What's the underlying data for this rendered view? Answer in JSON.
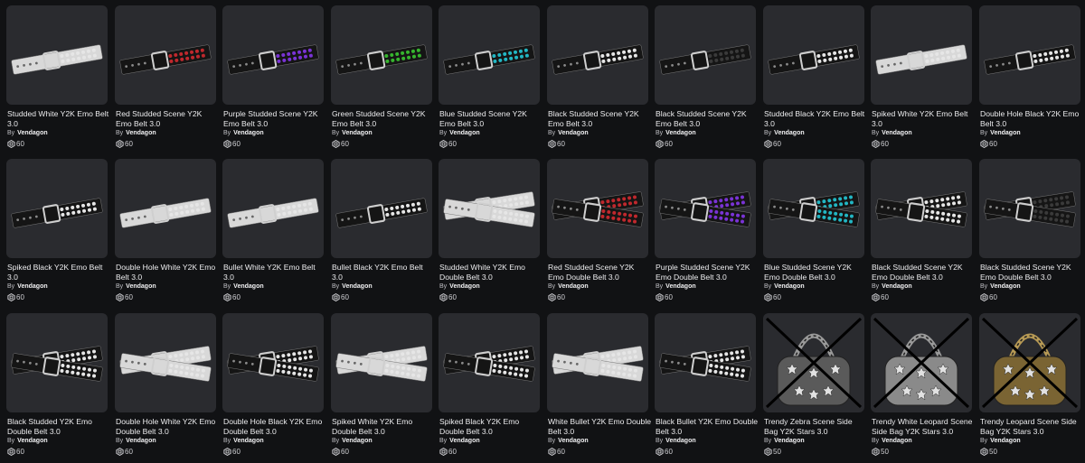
{
  "creator_prefix": "By",
  "colors": {
    "background": "#111214",
    "card_background": "#2a2b2f",
    "red": "#c0282d",
    "purple": "#7a33d6",
    "green": "#36b52e",
    "blue": "#22b6c3",
    "black": "#1a1a1a",
    "white": "#dcdcdc"
  },
  "items": [
    {
      "title": "Studded White Y2K Emo Belt 3.0",
      "creator": "Vendagon",
      "price": "60",
      "art": "belt",
      "strap": "white",
      "studs": "white",
      "crossed": false
    },
    {
      "title": "Red Studded Scene Y2K Emo Belt 3.0",
      "creator": "Vendagon",
      "price": "60",
      "art": "belt",
      "strap": "black",
      "studs": "red",
      "crossed": false
    },
    {
      "title": "Purple Studded Scene Y2K Emo Belt 3.0",
      "creator": "Vendagon",
      "price": "60",
      "art": "belt",
      "strap": "black",
      "studs": "purple",
      "crossed": false
    },
    {
      "title": "Green Studded Scene Y2K Emo Belt 3.0",
      "creator": "Vendagon",
      "price": "60",
      "art": "belt",
      "strap": "black",
      "studs": "green",
      "crossed": false
    },
    {
      "title": "Blue Studded Scene Y2K Emo Belt 3.0",
      "creator": "Vendagon",
      "price": "60",
      "art": "belt",
      "strap": "black",
      "studs": "blue",
      "crossed": false
    },
    {
      "title": "Black Studded Scene Y2K Emo Belt 3.0",
      "creator": "Vendagon",
      "price": "60",
      "art": "belt",
      "strap": "black",
      "studs": "white",
      "crossed": false
    },
    {
      "title": "Black Studded Scene Y2K Emo Belt 3.0",
      "creator": "Vendagon",
      "price": "60",
      "art": "belt",
      "strap": "black",
      "studs": "black",
      "crossed": false
    },
    {
      "title": "Studded Black Y2K Emo Belt 3.0",
      "creator": "Vendagon",
      "price": "60",
      "art": "belt",
      "strap": "black",
      "studs": "white",
      "crossed": false
    },
    {
      "title": "Spiked White Y2K Emo Belt 3.0",
      "creator": "Vendagon",
      "price": "60",
      "art": "belt",
      "strap": "white",
      "studs": "white",
      "crossed": false
    },
    {
      "title": "Double Hole Black Y2K Emo Belt 3.0",
      "creator": "Vendagon",
      "price": "60",
      "art": "belt",
      "strap": "black",
      "studs": "white",
      "crossed": false
    },
    {
      "title": "Spiked Black Y2K Emo Belt 3.0",
      "creator": "Vendagon",
      "price": "60",
      "art": "belt",
      "strap": "black",
      "studs": "white",
      "crossed": false
    },
    {
      "title": "Double Hole White Y2K Emo Belt 3.0",
      "creator": "Vendagon",
      "price": "60",
      "art": "belt",
      "strap": "white",
      "studs": "white",
      "crossed": false
    },
    {
      "title": "Bullet White Y2K Emo Belt 3.0",
      "creator": "Vendagon",
      "price": "60",
      "art": "belt",
      "strap": "white",
      "studs": "white",
      "crossed": false
    },
    {
      "title": "Bullet Black Y2K Emo Belt 3.0",
      "creator": "Vendagon",
      "price": "60",
      "art": "belt",
      "strap": "black",
      "studs": "white",
      "crossed": false
    },
    {
      "title": "Studded White Y2K Emo Double Belt 3.0",
      "creator": "Vendagon",
      "price": "60",
      "art": "double",
      "strap": "white",
      "studs": "white",
      "crossed": false
    },
    {
      "title": "Red Studded Scene Y2K Emo Double Belt 3.0",
      "creator": "Vendagon",
      "price": "60",
      "art": "double",
      "strap": "black",
      "studs": "red",
      "crossed": false
    },
    {
      "title": "Purple Studded Scene Y2K Emo Double Belt 3.0",
      "creator": "Vendagon",
      "price": "60",
      "art": "double",
      "strap": "black",
      "studs": "purple",
      "crossed": false
    },
    {
      "title": "Blue Studded Scene Y2K Emo Double Belt 3.0",
      "creator": "Vendagon",
      "price": "60",
      "art": "double",
      "strap": "black",
      "studs": "blue",
      "crossed": false
    },
    {
      "title": "Black Studded Scene Y2K Emo Double Belt 3.0",
      "creator": "Vendagon",
      "price": "60",
      "art": "double",
      "strap": "black",
      "studs": "white",
      "crossed": false
    },
    {
      "title": "Black Studded Scene Y2K Emo Double Belt 3.0",
      "creator": "Vendagon",
      "price": "60",
      "art": "double",
      "strap": "black",
      "studs": "black",
      "crossed": false
    },
    {
      "title": "Black Studded Y2K Emo Double Belt 3.0",
      "creator": "Vendagon",
      "price": "60",
      "art": "double",
      "strap": "black",
      "studs": "white",
      "crossed": false
    },
    {
      "title": "Double Hole White Y2K Emo Double Belt 3.0",
      "creator": "Vendagon",
      "price": "60",
      "art": "double",
      "strap": "white",
      "studs": "white",
      "crossed": false
    },
    {
      "title": "Double Hole Black Y2K Emo Double Belt 3.0",
      "creator": "Vendagon",
      "price": "60",
      "art": "double",
      "strap": "black",
      "studs": "white",
      "crossed": false
    },
    {
      "title": "Spiked White Y2K Emo Double Belt 3.0",
      "creator": "Vendagon",
      "price": "60",
      "art": "double",
      "strap": "white",
      "studs": "white",
      "crossed": false
    },
    {
      "title": "Spiked Black Y2K Emo Double Belt 3.0",
      "creator": "Vendagon",
      "price": "60",
      "art": "double",
      "strap": "black",
      "studs": "white",
      "crossed": false
    },
    {
      "title": "White Bullet Y2K Emo Double Belt 3.0",
      "creator": "Vendagon",
      "price": "60",
      "art": "double",
      "strap": "white",
      "studs": "white",
      "crossed": false
    },
    {
      "title": "Black Bullet Y2K Emo Double Belt 3.0",
      "creator": "Vendagon",
      "price": "60",
      "art": "double",
      "strap": "black",
      "studs": "white",
      "crossed": false
    },
    {
      "title": "Trendy Zebra Scene Side Bag Y2K Stars 3.0",
      "creator": "Vendagon",
      "price": "50",
      "art": "bag",
      "strap": "zebra",
      "studs": "white",
      "crossed": true
    },
    {
      "title": "Trendy White Leopard Scene Side Bag Y2K Stars 3.0",
      "creator": "Vendagon",
      "price": "50",
      "art": "bag",
      "strap": "silver",
      "studs": "white",
      "crossed": true
    },
    {
      "title": "Trendy Leopard Scene Side Bag Y2K Stars 3.0",
      "creator": "Vendagon",
      "price": "50",
      "art": "bag",
      "strap": "gold",
      "studs": "white",
      "crossed": true
    }
  ]
}
